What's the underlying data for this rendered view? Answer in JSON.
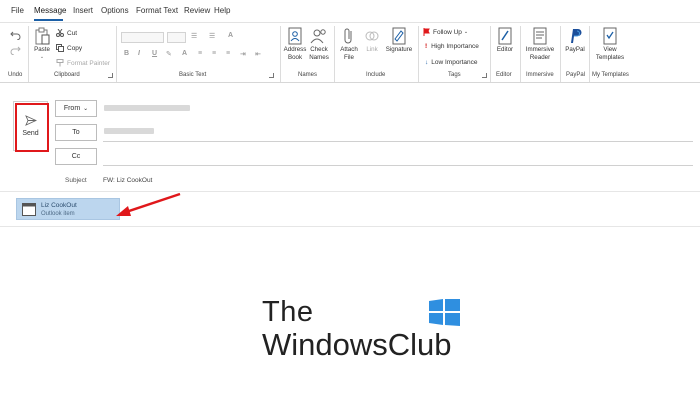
{
  "menu": {
    "tabs": [
      "File",
      "Message",
      "Insert",
      "Options",
      "Format Text",
      "Review",
      "Help"
    ],
    "active_tab": "Message"
  },
  "ribbon": {
    "groups": {
      "undo": "Undo",
      "clipboard": "Clipboard",
      "basic_text": "Basic Text",
      "names": "Names",
      "include": "Include",
      "tags": "Tags",
      "editor": "Editor",
      "immersive": "Immersive",
      "paypal": "PayPal",
      "my_templates": "My Templates"
    },
    "clipboard": {
      "paste": "Paste",
      "cut": "Cut",
      "copy": "Copy",
      "format_painter": "Format Painter"
    },
    "names": {
      "address_book_1": "Address",
      "address_book_2": "Book",
      "check_names_1": "Check",
      "check_names_2": "Names"
    },
    "include": {
      "attach_file_1": "Attach",
      "attach_file_2": "File",
      "link": "Link",
      "signature": "Signature"
    },
    "tags": {
      "follow_up": "Follow Up",
      "high_importance": "High Importance",
      "low_importance": "Low Importance"
    },
    "editor": "Editor",
    "immersive_reader_1": "Immersive",
    "immersive_reader_2": "Reader",
    "paypal": "PayPal",
    "view_templates_1": "View",
    "view_templates_2": "Templates"
  },
  "compose": {
    "send": "Send",
    "from": "From",
    "to": "To",
    "cc": "Cc",
    "subject_label": "Subject",
    "subject_value": "FW: Liz CookOut",
    "attachment": {
      "name": "Liz CookOut",
      "type": "Outlook item"
    }
  },
  "watermark": {
    "line1": "The",
    "line2": "WindowsClub"
  },
  "colors": {
    "accent": "#1b5fa6",
    "highlight_red": "#e0181b",
    "attachment_bg": "#bcd6ee"
  }
}
